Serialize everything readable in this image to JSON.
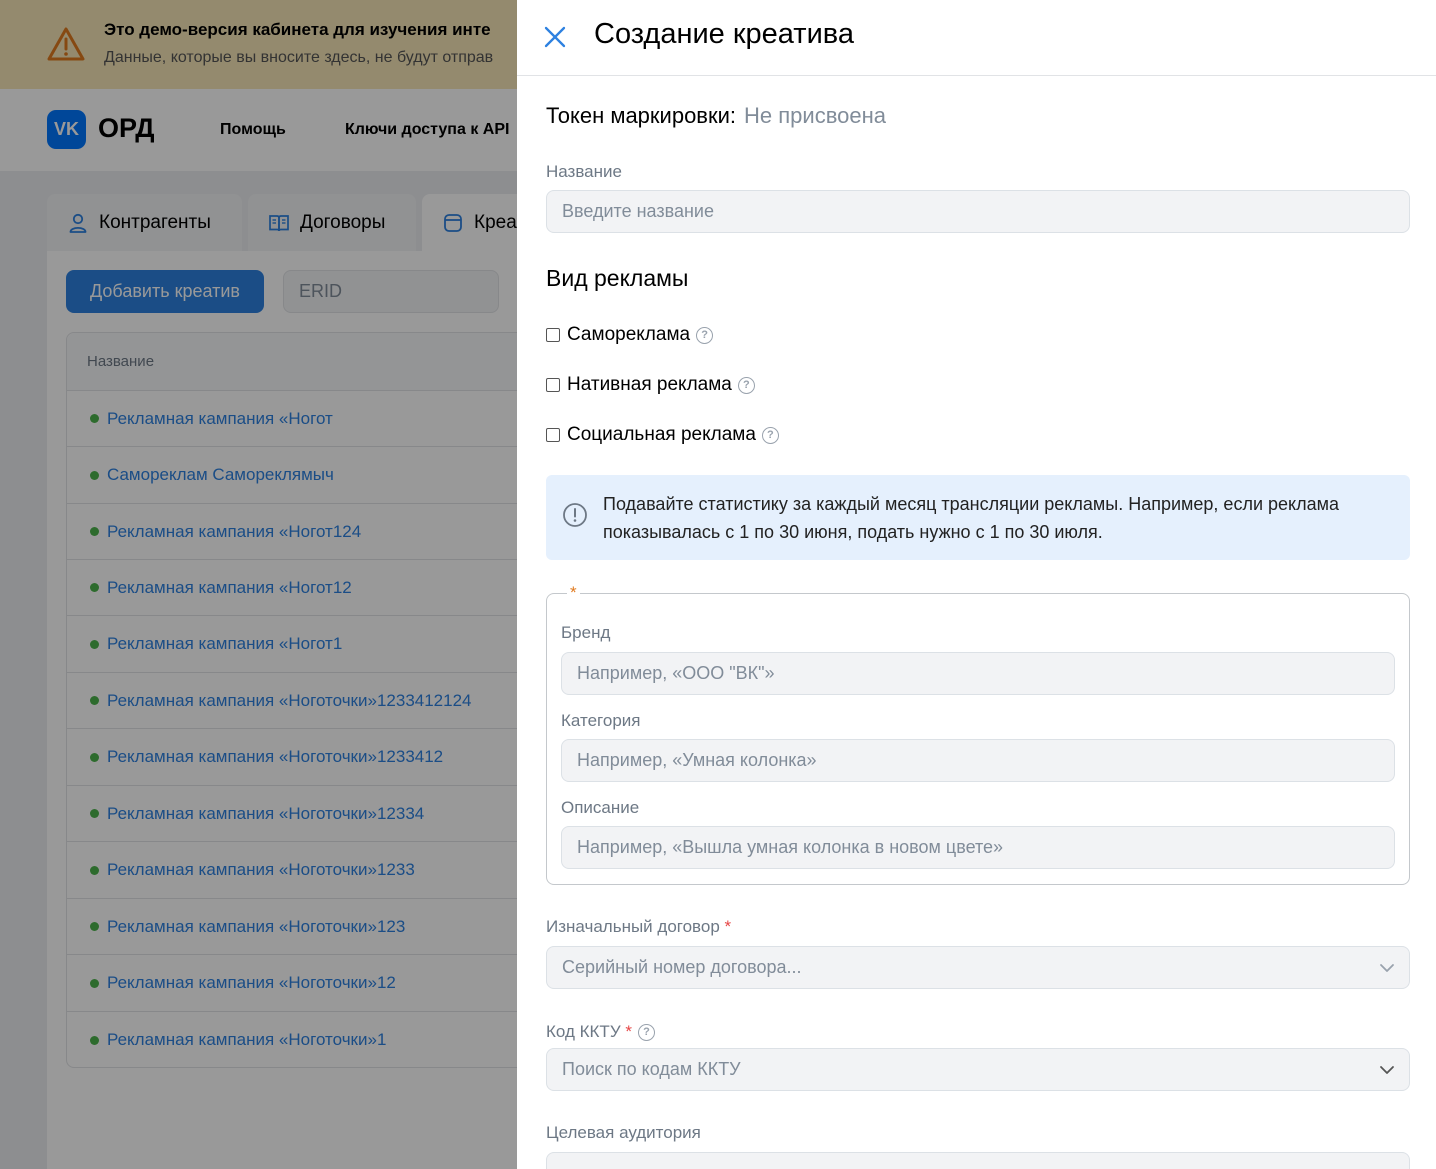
{
  "banner": {
    "line1": "Это демо-версия кабинета для изучения инте",
    "line2": "Данные, которые вы вносите здесь, не будут отправ"
  },
  "nav": {
    "logo_mark": "VK",
    "logo_text": "ОРД",
    "links": [
      "Помощь",
      "Ключи доступа к API"
    ]
  },
  "tabs": [
    "Контрагенты",
    "Договоры",
    "Креа"
  ],
  "toolbar": {
    "add_label": "Добавить креатив",
    "erid_placeholder": "ERID"
  },
  "table": {
    "header": "Название",
    "rows": [
      "Рекламная кампания «Ногот",
      "Самореклам Самореклямыч",
      "Рекламная кампания «Ногот124",
      "Рекламная кампания «Ногот12",
      "Рекламная кампания «Ногот1",
      "Рекламная кампания «Ноготочки»1233412124",
      "Рекламная кампания «Ноготочки»1233412",
      "Рекламная кампания «Ноготочки»12334",
      "Рекламная кампания «Ноготочки»1233",
      "Рекламная кампания «Ноготочки»123",
      "Рекламная кампания «Ноготочки»12",
      "Рекламная кампания «Ноготочки»1"
    ]
  },
  "panel": {
    "title": "Создание креатива",
    "token_label": "Токен маркировки:",
    "token_value": "Не присвоена",
    "name_label": "Название",
    "name_placeholder": "Введите название",
    "ad_type_title": "Вид рекламы",
    "checks": [
      "Самореклама",
      "Нативная реклама",
      "Социальная реклама"
    ],
    "info_text": "Подавайте статистику за каждый месяц трансляции рекламы. Например, если реклама показывалась с 1 по 30 июня, подать нужно с 1 по 30 июля.",
    "group_star": "*",
    "brand_label": "Бренд",
    "brand_placeholder": "Например, «ООО \"ВК\"»",
    "category_label": "Категория",
    "category_placeholder": "Например, «Умная колонка»",
    "description_label": "Описание",
    "description_placeholder": "Например, «Вышла умная колонка в новом цвете»",
    "contract_label": "Изначальный договор",
    "contract_placeholder": "Серийный номер договора...",
    "kktu_label": "Код ККТУ",
    "kktu_placeholder": "Поиск по кодам ККТУ",
    "audience_label": "Целевая аудитория",
    "required_mark": "*"
  },
  "colors": {
    "accent": "#2d81e0",
    "status_green": "#4bb34b",
    "info_bg": "#e5f0fd",
    "warning": "#e07a1f"
  }
}
